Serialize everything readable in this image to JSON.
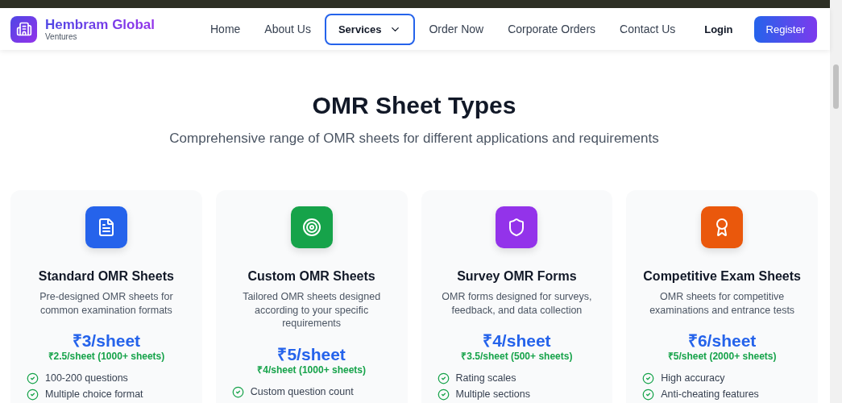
{
  "header": {
    "brand": {
      "name": "Hembram Global",
      "tagline": "Ventures"
    },
    "nav": [
      {
        "label": "Home",
        "selected": false,
        "dropdown": false
      },
      {
        "label": "About Us",
        "selected": false,
        "dropdown": false
      },
      {
        "label": "Services",
        "selected": true,
        "dropdown": true
      },
      {
        "label": "Order Now",
        "selected": false,
        "dropdown": false
      },
      {
        "label": "Corporate Orders",
        "selected": false,
        "dropdown": false
      },
      {
        "label": "Contact Us",
        "selected": false,
        "dropdown": false
      }
    ],
    "login": "Login",
    "register": "Register"
  },
  "section": {
    "title": "OMR Sheet Types",
    "subtitle": "Comprehensive range of OMR sheets for different applications and requirements"
  },
  "cards": [
    {
      "color": "#2563eb",
      "title": "Standard OMR Sheets",
      "description": "Pre-designed OMR sheets for common examination formats",
      "price": "₹3/sheet",
      "bulk_price": "₹2.5/sheet (1000+ sheets)",
      "features": [
        "100-200 questions",
        "Multiple choice format"
      ]
    },
    {
      "color": "#16a34a",
      "title": "Custom OMR Sheets",
      "description": "Tailored OMR sheets designed according to your specific requirements",
      "price": "₹5/sheet",
      "bulk_price": "₹4/sheet (1000+ sheets)",
      "features": [
        "Custom question count"
      ]
    },
    {
      "color": "#9333ea",
      "title": "Survey OMR Forms",
      "description": "OMR forms designed for surveys, feedback, and data collection",
      "price": "₹4/sheet",
      "bulk_price": "₹3.5/sheet (500+ sheets)",
      "features": [
        "Rating scales",
        "Multiple sections"
      ]
    },
    {
      "color": "#ea580c",
      "title": "Competitive Exam Sheets",
      "description": "OMR sheets for competitive examinations and entrance tests",
      "price": "₹6/sheet",
      "bulk_price": "₹5/sheet (2000+ sheets)",
      "features": [
        "High accuracy",
        "Anti-cheating features"
      ]
    }
  ]
}
